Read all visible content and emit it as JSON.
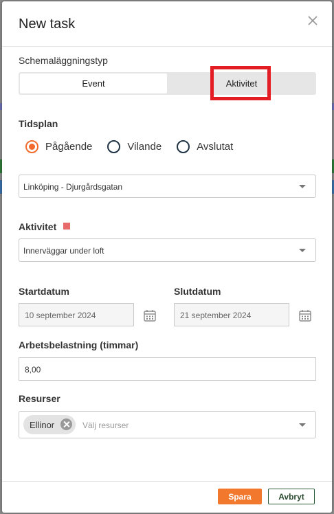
{
  "dialog": {
    "title": "New task"
  },
  "scheduling": {
    "label": "Schemaläggningstyp",
    "options": [
      "Event",
      "Aktivitet"
    ]
  },
  "schedule": {
    "label": "Tidsplan",
    "radios": [
      {
        "label": "Pågående",
        "selected": true
      },
      {
        "label": "Vilande",
        "selected": false
      },
      {
        "label": "Avslutat",
        "selected": false
      }
    ],
    "location_value": "Linköping - Djurgårdsgatan"
  },
  "activity": {
    "label": "Aktivitet",
    "value": "Innerväggar under loft",
    "color": "#e86b6b"
  },
  "dates": {
    "start_label": "Startdatum",
    "start_value": "10 september 2024",
    "end_label": "Slutdatum",
    "end_value": "21 september 2024"
  },
  "workload": {
    "label": "Arbetsbelastning (timmar)",
    "value": "8,00"
  },
  "resources": {
    "label": "Resurser",
    "chip": "Ellinor",
    "placeholder": "Välj resurser"
  },
  "footer": {
    "save": "Spara",
    "cancel": "Avbryt"
  },
  "colors": {
    "accent": "#f2782d",
    "highlight": "#e41d25",
    "dark_outline": "#2b5a35"
  }
}
